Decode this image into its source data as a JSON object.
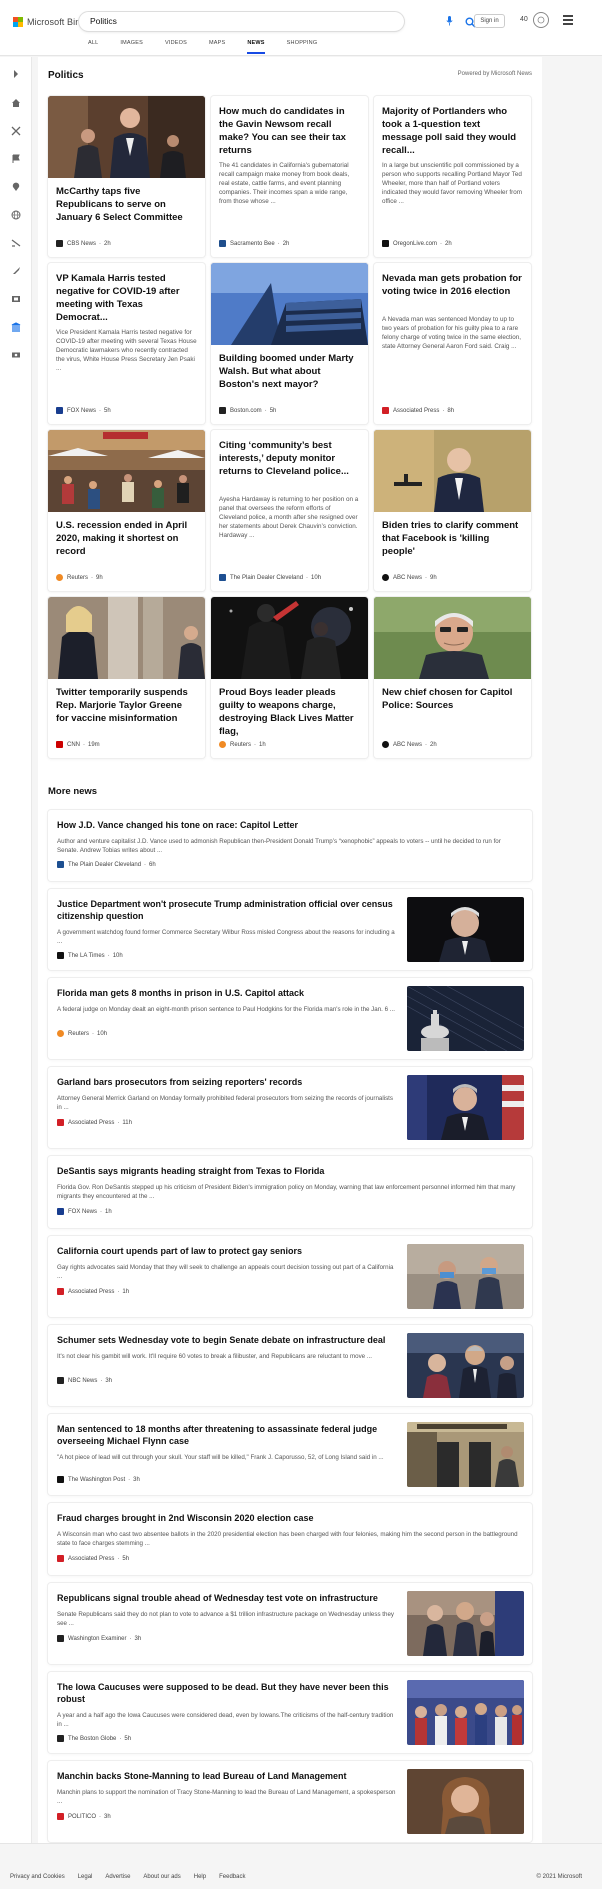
{
  "header": {
    "brand": "Microsoft Bing",
    "query": "Politics",
    "signin": "Sign in",
    "points": "40",
    "tabs": [
      "ALL",
      "IMAGES",
      "VIDEOS",
      "MAPS",
      "NEWS",
      "SHOPPING"
    ],
    "active_tab": "NEWS"
  },
  "section_title": "Politics",
  "powered_by": "Powered by Microsoft News",
  "cards": [
    {
      "title": "McCarthy taps five Republicans to serve on January 6 Select Committee",
      "desc": "",
      "source": "CBS News",
      "time": "2h",
      "logo_color": "#222"
    },
    {
      "title": "How much do candidates in the Gavin Newsom recall make? You can see their tax returns",
      "desc": "The 41 candidates in California's gubernatorial recall campaign make money from book deals, real estate, cattle farms, and event planning companies. Their incomes span a wide range, from those whose ...",
      "source": "Sacramento Bee",
      "time": "2h",
      "logo_color": "#1f4e8c"
    },
    {
      "title": "Majority of Portlanders who took a 1-question text message poll said they would recall...",
      "desc": "In a large but unscientific poll commissioned by a person who supports recalling Portland Mayor Ted Wheeler, more than half of Portland voters indicated they would favor removing Wheeler from office ...",
      "source": "OregonLive.com",
      "time": "2h",
      "logo_color": "#111"
    },
    {
      "title": "VP Kamala Harris tested negative for COVID-19 after meeting with Texas Democrat...",
      "desc": "Vice President Kamala Harris tested negative for COVID-19 after meeting with several Texas House Democratic lawmakers who recently contracted the virus, White House Press Secretary Jen Psaki ...",
      "source": "FOX News",
      "time": "5h",
      "logo_color": "#183d8f"
    },
    {
      "title": "Building boomed under Marty Walsh. But what about Boston's next mayor?",
      "desc": "",
      "source": "Boston.com",
      "time": "5h",
      "logo_color": "#222"
    },
    {
      "title": "Nevada man gets probation for voting twice in 2016 election",
      "desc": "A Nevada man was sentenced Monday to up to two years of probation for his guilty plea to a rare felony charge of voting twice in the same election, state Attorney General Aaron Ford said. Craig ...",
      "source": "Associated Press",
      "time": "8h",
      "logo_color": "#d21f26"
    },
    {
      "title": "U.S. recession ended in April 2020, making it shortest on record",
      "desc": "",
      "source": "Reuters",
      "time": "9h",
      "logo_color": "#f08a24"
    },
    {
      "title": "Citing ‘community’s best interests,’ deputy monitor returns to Cleveland police...",
      "desc": "Ayesha Hardaway is returning to her position on a panel that oversees the reform efforts of Cleveland police, a month after she resigned over her statements about Derek Chauvin’s conviction. Hardaway ...",
      "source": "The Plain Dealer Cleveland",
      "time": "10h",
      "logo_color": "#1d4f91"
    },
    {
      "title": "Biden tries to clarify comment that Facebook is 'killing people'",
      "desc": "",
      "source": "ABC News",
      "time": "9h",
      "logo_color": "#111"
    },
    {
      "title": "Twitter temporarily suspends Rep. Marjorie Taylor Greene for vaccine misinformation",
      "desc": "",
      "source": "CNN",
      "time": "19m",
      "logo_color": "#cc0000"
    },
    {
      "title": "Proud Boys leader pleads guilty to weapons charge, destroying Black Lives Matter flag,",
      "desc": "",
      "source": "Reuters",
      "time": "1h",
      "logo_color": "#f08a24"
    },
    {
      "title": "New chief chosen for Capitol Police: Sources",
      "desc": "",
      "source": "ABC News",
      "time": "2h",
      "logo_color": "#111"
    }
  ],
  "more_news_title": "More news",
  "more_news": [
    {
      "title": "How J.D. Vance changed his tone on race: Capitol Letter",
      "desc": "Author and venture capitalist J.D. Vance used to admonish Republican then-President Donald Trump’s “xenophobic” appeals to voters -- until he decided to run for Senate. Andrew Tobias writes about ...",
      "source": "The Plain Dealer Cleveland",
      "time": "6h",
      "logo_color": "#1d4f91"
    },
    {
      "title": "Justice Department won't prosecute Trump administration official over census citizenship question",
      "desc": "A government watchdog found former Commerce Secretary Wilbur Ross misled Congress about the reasons for including a ...",
      "source": "The LA Times",
      "time": "10h",
      "logo_color": "#111"
    },
    {
      "title": "Florida man gets 8 months in prison in U.S. Capitol attack",
      "desc": "A federal judge on Monday dealt an eight-month prison sentence to Paul Hodgkins for the Florida man's role in the Jan. 6 ...",
      "source": "Reuters",
      "time": "10h",
      "logo_color": "#f08a24"
    },
    {
      "title": "Garland bars prosecutors from seizing reporters' records",
      "desc": "Attorney General Merrick Garland on Monday formally prohibited federal prosecutors from seizing the records of journalists in ...",
      "source": "Associated Press",
      "time": "11h",
      "logo_color": "#d21f26"
    },
    {
      "title": "DeSantis says migrants heading straight from Texas to Florida",
      "desc": "Florida Gov. Ron DeSantis stepped up his criticism of President Biden's immigration policy on Monday, warning that law enforcement personnel informed him that many migrants they encountered at the ...",
      "source": "FOX News",
      "time": "1h",
      "logo_color": "#183d8f"
    },
    {
      "title": "California court upends part of law to protect gay seniors",
      "desc": "Gay rights advocates said Monday that they will seek to challenge an appeals court decision tossing out part of a California ...",
      "source": "Associated Press",
      "time": "1h",
      "logo_color": "#d21f26"
    },
    {
      "title": "Schumer sets Wednesday vote to begin Senate debate on infrastructure deal",
      "desc": "It's not clear his gambit will work. It'll require 60 votes to break a filibuster, and Republicans are reluctant to move ...",
      "source": "NBC News",
      "time": "3h",
      "logo_color": "#222"
    },
    {
      "title": "Man sentenced to 18 months after threatening to assassinate federal judge overseeing Michael Flynn case",
      "desc": "\"A hot piece of lead will cut through your skull. Your staff will be killed,\" Frank J. Caporusso, 52, of Long Island said in ...",
      "source": "The Washington Post",
      "time": "3h",
      "logo_color": "#111"
    },
    {
      "title": "Fraud charges brought in 2nd Wisconsin 2020 election case",
      "desc": "A Wisconsin man who cast two absentee ballots in the 2020 presidential election has been charged with four felonies, making him the second person in the battleground state to face charges stemming ...",
      "source": "Associated Press",
      "time": "5h",
      "logo_color": "#d21f26"
    },
    {
      "title": "Republicans signal trouble ahead of Wednesday test vote on infrastructure",
      "desc": "Senate Republicans said they do not plan to vote to advance a $1 trillion infrastructure package on Wednesday unless they see ...",
      "source": "Washington Examiner",
      "time": "3h",
      "logo_color": "#222"
    },
    {
      "title": "The Iowa Caucuses were supposed to be dead. But they have never been this robust",
      "desc": "A year and a half ago the Iowa Caucuses were considered dead, even by Iowans.The criticisms of the half-century tradition in ...",
      "source": "The Boston Globe",
      "time": "5h",
      "logo_color": "#222"
    },
    {
      "title": "Manchin backs Stone-Manning to lead Bureau of Land Management",
      "desc": "Manchin plans to support the nomination of Tracy Stone-Manning to lead the Bureau of Land Management, a spokesperson ...",
      "source": "POLITICO",
      "time": "3h",
      "logo_color": "#d21f26"
    }
  ],
  "footer": {
    "links": [
      "Privacy and Cookies",
      "Legal",
      "Advertise",
      "About our ads",
      "Help",
      "Feedback"
    ],
    "copyright": "© 2021 Microsoft"
  }
}
